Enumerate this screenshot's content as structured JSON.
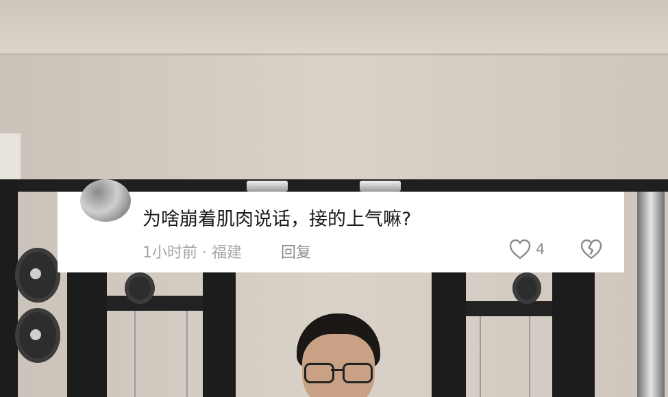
{
  "comment": {
    "text": "为啥崩着肌肉说话，接的上气嘛?",
    "meta": "1小时前 · 福建",
    "reply_label": "回复",
    "like_count": "4"
  },
  "icons": {
    "like": "heart-outline-icon",
    "dislike": "broken-heart-icon"
  },
  "colors": {
    "card_background": "#ffffff",
    "comment_text": "#1b1b1b",
    "meta_text": "#a4a4a4"
  }
}
